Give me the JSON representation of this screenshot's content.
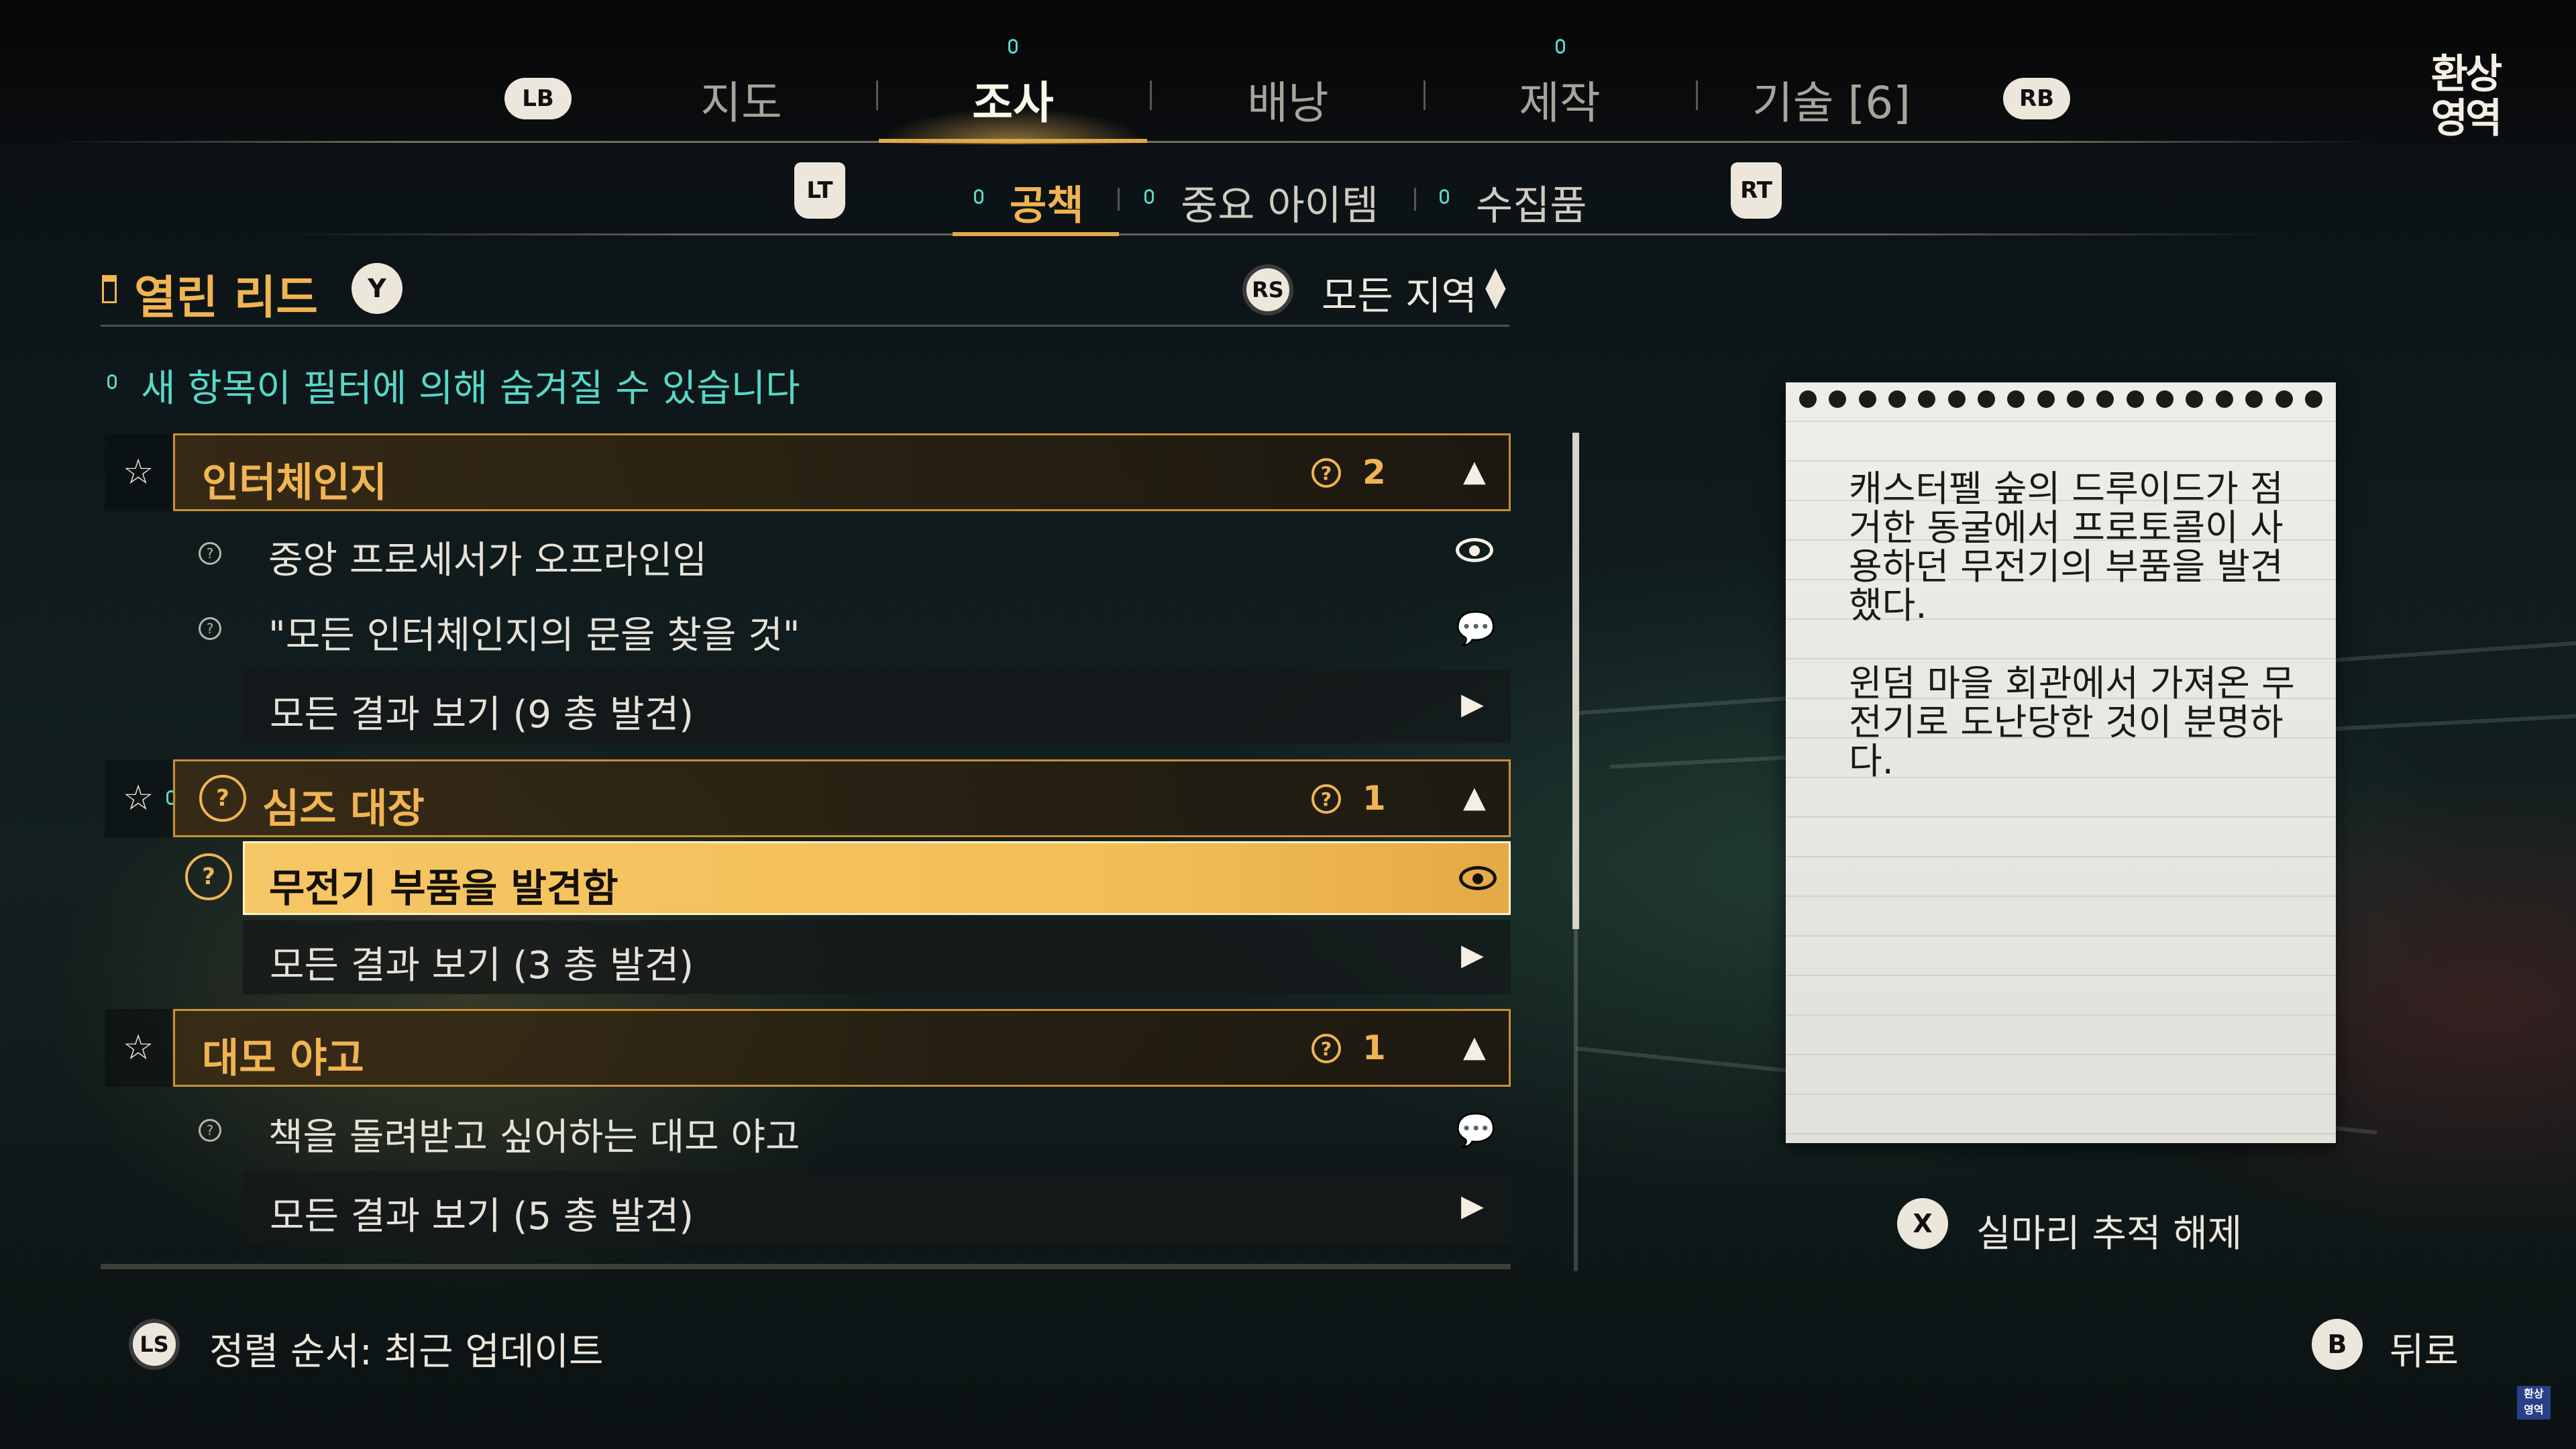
{
  "nav": {
    "left_bumper": "LB",
    "right_bumper": "RB",
    "tabs": [
      {
        "label": "지도",
        "active": false,
        "new_indicator": false
      },
      {
        "label": "조사",
        "active": true,
        "new_indicator": true
      },
      {
        "label": "배낭",
        "active": false,
        "new_indicator": false
      },
      {
        "label": "제작",
        "active": false,
        "new_indicator": true
      },
      {
        "label": "기술 [6]",
        "active": false,
        "new_indicator": false
      }
    ]
  },
  "logo": {
    "line1": "환상",
    "line2": "영역"
  },
  "subnav": {
    "left_trigger": "LT",
    "right_trigger": "RT",
    "tabs": [
      {
        "label": "공책",
        "active": true
      },
      {
        "label": "중요 아이템",
        "active": false
      },
      {
        "label": "수집품",
        "active": false
      }
    ]
  },
  "leads": {
    "title": "열린 리드",
    "title_button": "Y",
    "filter_button": "RS",
    "filter_value": "모든 지역",
    "notice": "새 항목이 필터에 의해 숨겨질 수 있습니다",
    "groups": [
      {
        "title": "인터체인지",
        "count": "2",
        "entries": [
          {
            "label": "중앙 프로세서가 오프라인임",
            "icon": "eye-icon"
          },
          {
            "label": "\"모든 인터체인지의 문을 찾을 것\"",
            "icon": "chat-icon"
          }
        ],
        "see_all": "모든 결과 보기 (9 총 발견)"
      },
      {
        "title": "심즈 대장",
        "count": "1",
        "selected_entry": "무전기 부품을 발견함",
        "see_all": "모든 결과 보기 (3 총 발견)"
      },
      {
        "title": "대모 야고",
        "count": "1",
        "entries": [
          {
            "label": "책을 돌려받고 싶어하는 대모 야고",
            "icon": "chat-icon"
          }
        ],
        "see_all": "모든 결과 보기 (5 총 발견)"
      }
    ]
  },
  "note": {
    "text": "캐스터펠 숲의 드루이드가 점거한 동굴에서 프로토콜이 사용하던 무전기의 부품을 발견했다.\n\n윈덤 마을 회관에서 가져온 무전기로 도난당한 것이 분명하다."
  },
  "actions": {
    "untrack_button": "X",
    "untrack_label": "실마리 추적 해제",
    "sort_button": "LS",
    "sort_label": "정렬 순서: 최근 업데이트",
    "back_button": "B",
    "back_label": "뒤로"
  },
  "colors": {
    "accent": "#f1b452",
    "new": "#57d8c8",
    "selected": "#f3bd56"
  }
}
